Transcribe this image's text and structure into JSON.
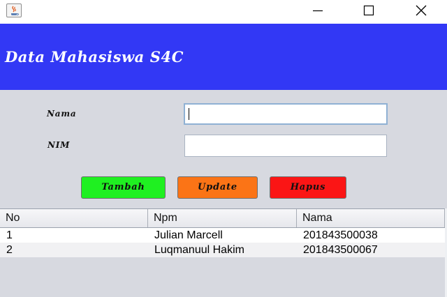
{
  "window": {
    "icon": "java-coffee-icon",
    "controls": {
      "minimize": "minimize-icon",
      "maximize": "maximize-icon",
      "close": "close-icon"
    }
  },
  "banner": {
    "title": "Data Mahasiswa S4C",
    "color": "#3238f5"
  },
  "form": {
    "nama_label": "Nama",
    "nama_value": "",
    "nim_label": "NIM",
    "nim_value": ""
  },
  "buttons": {
    "tambah": {
      "label": "Tambah",
      "color": "#1ff021"
    },
    "update": {
      "label": "Update",
      "color": "#fb7416"
    },
    "hapus": {
      "label": "Hapus",
      "color": "#fb1515"
    }
  },
  "table": {
    "columns": [
      "No",
      "Npm",
      "Nama"
    ],
    "rows": [
      [
        "1",
        "Julian Marcell",
        "201843500038"
      ],
      [
        "2",
        "Luqmanuul Hakim",
        "201843500067"
      ]
    ]
  },
  "colors": {
    "panel_bg": "#d7d9e0"
  }
}
